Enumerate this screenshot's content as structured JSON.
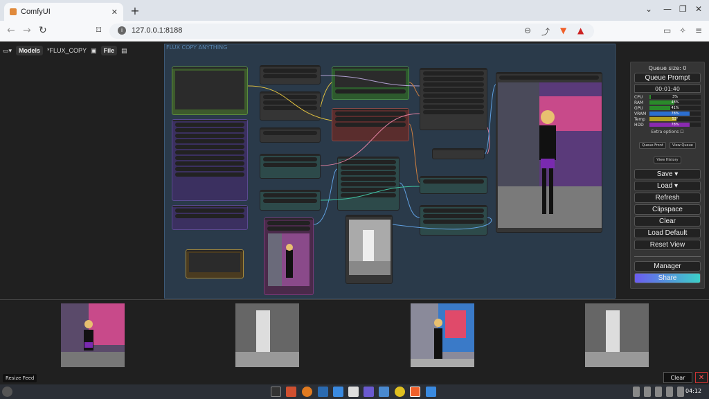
{
  "browser": {
    "tab_title": "ComfyUI",
    "tab_close": "✕",
    "new_tab": "+",
    "url": "127.0.0.1:8188",
    "win_min": "—",
    "win_max": "❐",
    "win_close": "✕"
  },
  "menu": {
    "models": "Models",
    "workflow_name": "*FLUX_COPY",
    "file": "File"
  },
  "canvas": {
    "group_title": "FLUX COPY ANYTHING"
  },
  "queue": {
    "queue_size": "Queue size: 0",
    "queue_prompt": "Queue Prompt",
    "timer": "00:01:40",
    "stats": [
      {
        "label": "CPU",
        "value": "3%",
        "pct": 3,
        "color": "#2a8a2a"
      },
      {
        "label": "RAM",
        "value": "48%",
        "pct": 48,
        "color": "#2a8a2a"
      },
      {
        "label": "GPU",
        "value": "41%",
        "pct": 41,
        "color": "#2a8a2a"
      },
      {
        "label": "VRAM",
        "value": "78%",
        "pct": 78,
        "color": "#2c6fd0"
      },
      {
        "label": "Temp",
        "value": "53°",
        "pct": 53,
        "color": "#b0a020"
      },
      {
        "label": "HDD",
        "value": "78%",
        "pct": 78,
        "color": "#8a2ab0"
      }
    ],
    "extra_options": "Extra options",
    "queue_front": "Queue Front",
    "view_queue": "View Queue",
    "view_history": "View History",
    "save": "Save",
    "load": "Load",
    "refresh": "Refresh",
    "clipspace": "Clipspace",
    "clear": "Clear",
    "load_default": "Load Default",
    "reset_view": "Reset View",
    "manager": "Manager",
    "share": "Share"
  },
  "feed": {
    "resize": "Resize Feed",
    "clear": "Clear",
    "close": "✕"
  },
  "taskbar": {
    "time": "04:12"
  }
}
